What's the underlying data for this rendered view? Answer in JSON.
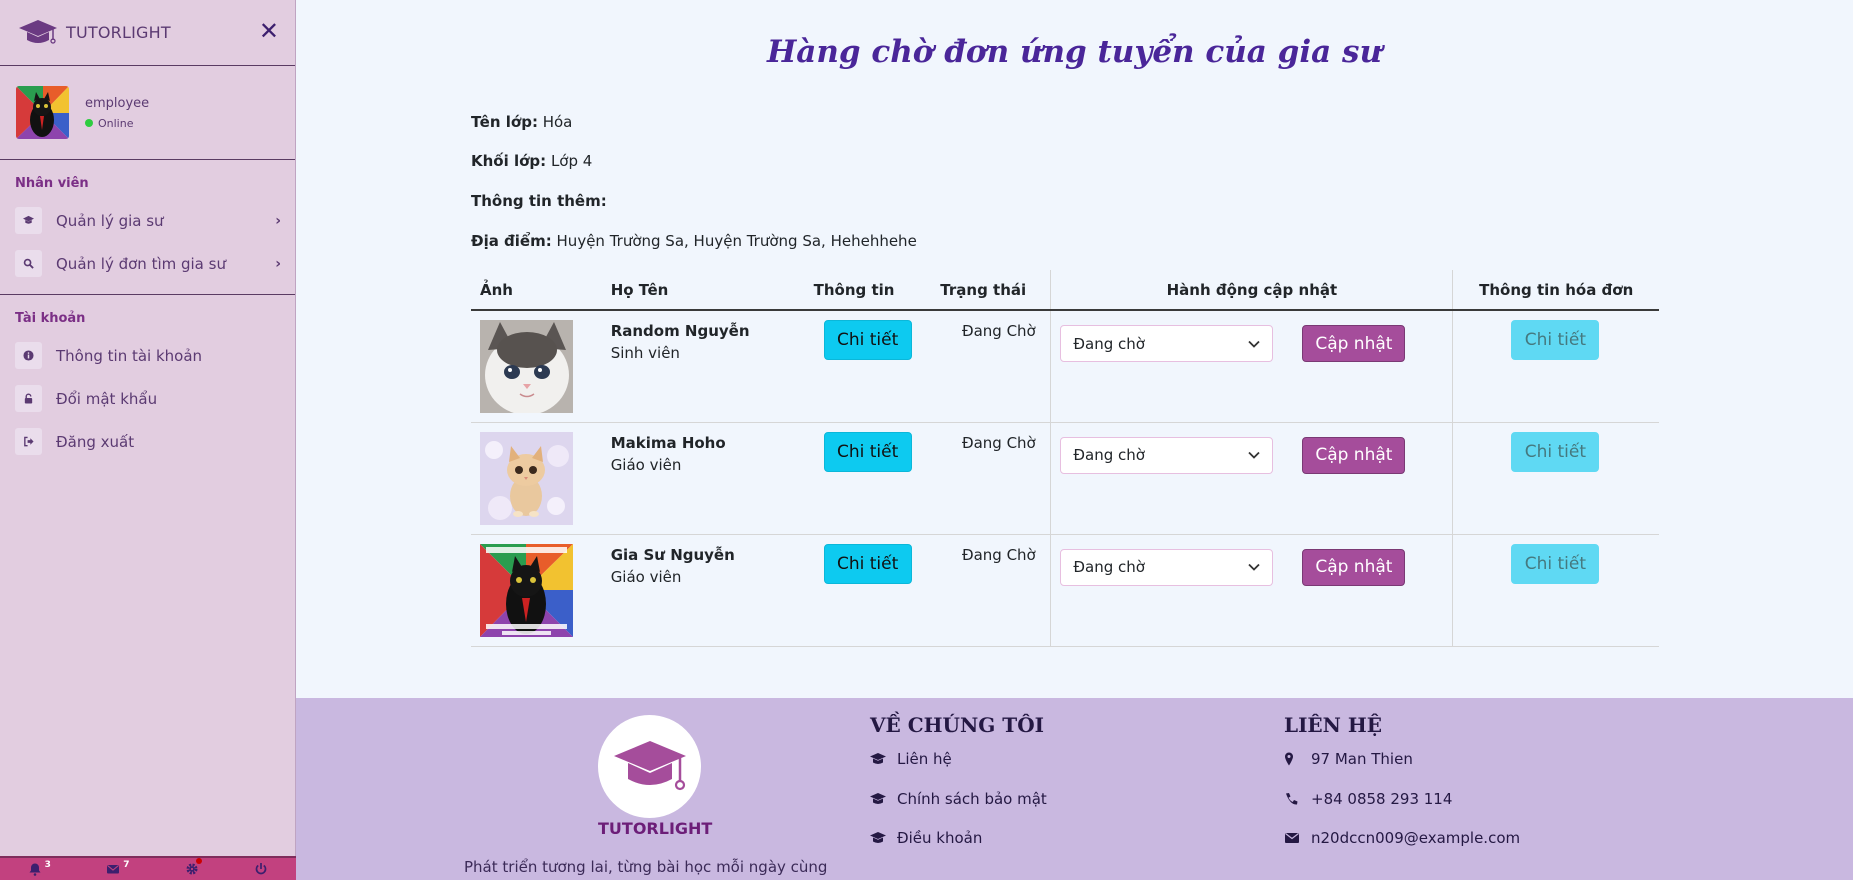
{
  "brand": {
    "name": "TUTORLIGHT"
  },
  "user": {
    "name": "employee",
    "status": "Online"
  },
  "sidebar": {
    "sections": [
      {
        "title": "Nhân viên",
        "items": [
          {
            "label": "Quản lý gia sư",
            "icon": "graduation-cap-icon"
          },
          {
            "label": "Quản lý đơn tìm gia sư",
            "icon": "search-icon"
          }
        ]
      },
      {
        "title": "Tài khoản",
        "items": [
          {
            "label": "Thông tin tài khoản",
            "icon": "info-icon"
          },
          {
            "label": "Đổi mật khẩu",
            "icon": "lock-icon"
          },
          {
            "label": "Đăng xuất",
            "icon": "sign-out-icon"
          }
        ]
      }
    ],
    "bottom_bar": {
      "notifications": "3",
      "messages": "7"
    }
  },
  "page": {
    "title": "Hàng chờ đơn ứng tuyển của gia sư",
    "class_info": [
      {
        "label": "Tên lớp:",
        "value": "Hóa"
      },
      {
        "label": "Khối lớp:",
        "value": "Lớp 4"
      },
      {
        "label": "Thông tin thêm:",
        "value": ""
      },
      {
        "label": "Địa điểm:",
        "value": "Huyện Trường Sa, Huyện Trường Sa, Hehehhehe"
      }
    ]
  },
  "table": {
    "headers": [
      "Ảnh",
      "Họ Tên",
      "Thông tin",
      "Trạng thái",
      "Hành động cập nhật",
      "Thông tin hóa đơn"
    ],
    "rows": [
      {
        "name": "Random Nguyễn",
        "role": "Sinh viên",
        "info_button": "Chi tiết",
        "status": "Đang Chờ",
        "select_value": "Đang chờ",
        "update_button": "Cập nhật",
        "bill_button": "Chi tiết"
      },
      {
        "name": "Makima Hoho",
        "role": "Giáo viên",
        "info_button": "Chi tiết",
        "status": "Đang Chờ",
        "select_value": "Đang chờ",
        "update_button": "Cập nhật",
        "bill_button": "Chi tiết"
      },
      {
        "name": "Gia Sư Nguyễn",
        "role": "Giáo viên",
        "info_button": "Chi tiết",
        "status": "Đang Chờ",
        "select_value": "Đang chờ",
        "update_button": "Cập nhật",
        "bill_button": "Chi tiết"
      }
    ]
  },
  "footer": {
    "brand": "TUTORLIGHT",
    "tagline": "Phát triển tương lai, từng bài học mỗi ngày cùng",
    "about": {
      "title": "VỀ CHÚNG TÔI",
      "links": [
        "Liên hệ",
        "Chính sách bảo mật",
        "Điều khoản"
      ]
    },
    "contact": {
      "title": "LIÊN HỆ",
      "address": "97 Man Thien",
      "phone": "+84 0858 293 114",
      "email": "n20dccn009@example.com"
    }
  },
  "colors": {
    "sidebar_bg": "#e2cde0",
    "title": "#4a2699",
    "cyan_button": "#0dcaf0",
    "purple_button": "#a54d9b",
    "footer_bg": "#c9b8e0"
  }
}
